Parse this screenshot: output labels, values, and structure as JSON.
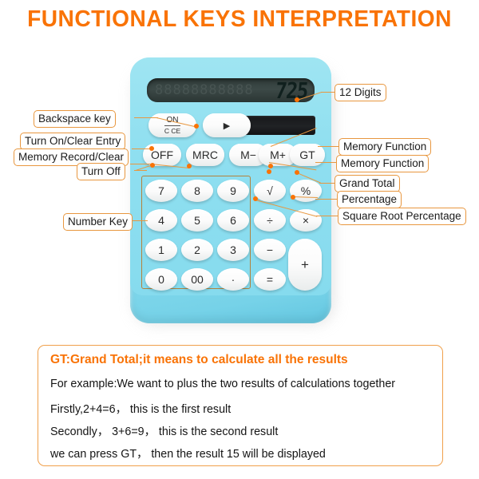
{
  "page": {
    "title": "FUNCTIONAL KEYS INTERPRETATION",
    "accent_color": "#f97306",
    "label_border_color": "#e8973f",
    "body_color": "#8edef0"
  },
  "callouts": {
    "left": [
      {
        "id": "backspace",
        "label": "Backspace key"
      },
      {
        "id": "turn-on-clear",
        "label": "Turn On/Clear Entry"
      },
      {
        "id": "memory-record",
        "label": "Memory Record/Clear"
      },
      {
        "id": "turn-off",
        "label": "Turn Off"
      },
      {
        "id": "number-key",
        "label": "Number Key"
      }
    ],
    "right": [
      {
        "id": "digits",
        "label": "12 Digits"
      },
      {
        "id": "memory-minus",
        "label": "Memory Function"
      },
      {
        "id": "memory-plus",
        "label": "Memory Function"
      },
      {
        "id": "grand-total",
        "label": "Grand Total"
      },
      {
        "id": "percentage",
        "label": "Percentage"
      },
      {
        "id": "square-root-pct",
        "label": "Square Root Percentage"
      }
    ]
  },
  "calculator": {
    "display_value": "725",
    "display_ghost": "88888888888",
    "function_keys": {
      "on_top": "ON",
      "on_bottom": "C CE",
      "backspace": "▶",
      "off": "OFF",
      "mrc": "MRC",
      "m_minus": "M−",
      "m_plus": "M+",
      "gt": "GT"
    },
    "operator_keys": {
      "sqrt": "√",
      "percent": "%",
      "divide": "÷",
      "multiply": "×",
      "minus": "−",
      "equals": "=",
      "plus": "+"
    },
    "number_keys": [
      [
        "7",
        "8",
        "9"
      ],
      [
        "4",
        "5",
        "6"
      ],
      [
        "1",
        "2",
        "3"
      ],
      [
        "0",
        "00",
        "·"
      ]
    ]
  },
  "explanation": {
    "heading": "GT:Grand Total;it means to calculate all the results",
    "lines": [
      "For example:We want to plus the two  results of calculations together",
      "Firstly,2+4=6， this is the first result",
      "Secondly， 3+6=9， this is the second result",
      "we can press GT， then the result 15 will be displayed"
    ]
  }
}
